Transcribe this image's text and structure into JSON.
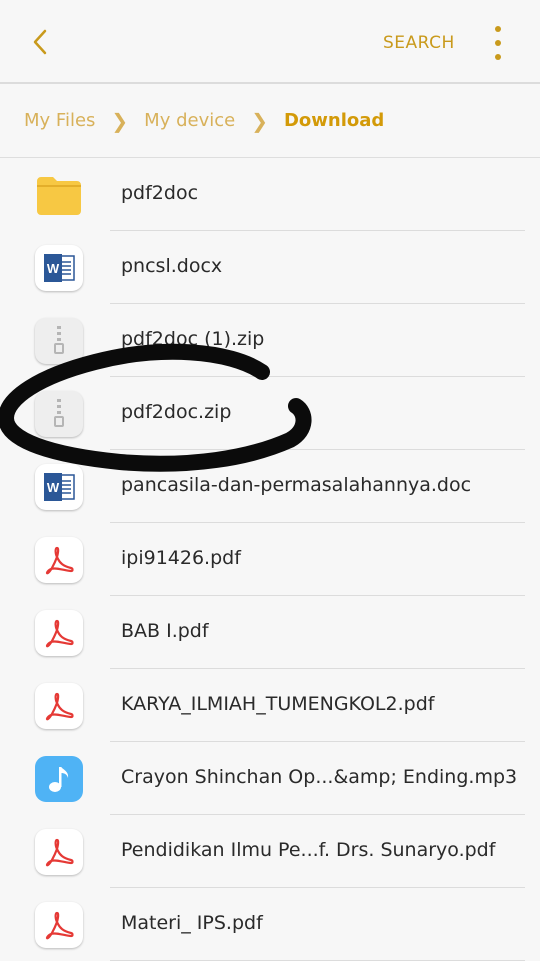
{
  "header": {
    "search_label": "SEARCH"
  },
  "breadcrumb": {
    "items": [
      "My Files",
      "My device",
      "Download"
    ]
  },
  "files": [
    {
      "name": "pdf2doc",
      "type": "folder"
    },
    {
      "name": "pncsl.docx",
      "type": "word"
    },
    {
      "name": "pdf2doc (1).zip",
      "type": "zip"
    },
    {
      "name": "pdf2doc.zip",
      "type": "zip"
    },
    {
      "name": "pancasila-dan-permasalahannya.doc",
      "type": "word"
    },
    {
      "name": "ipi91426.pdf",
      "type": "pdf"
    },
    {
      "name": "BAB I.pdf",
      "type": "pdf"
    },
    {
      "name": "KARYA_ILMIAH_TUMENGKOL2.pdf",
      "type": "pdf"
    },
    {
      "name": "Crayon Shinchan Op...&amp; Ending.mp3",
      "type": "music"
    },
    {
      "name": "Pendidikan Ilmu Pe...f. Drs. Sunaryo.pdf",
      "type": "pdf"
    },
    {
      "name": "Materi_ IPS.pdf",
      "type": "pdf"
    }
  ],
  "colors": {
    "accent": "#c99a1c",
    "folder": "#f7c843",
    "word": "#2b5797",
    "pdf": "#e53935",
    "music": "#4fb3f5"
  }
}
